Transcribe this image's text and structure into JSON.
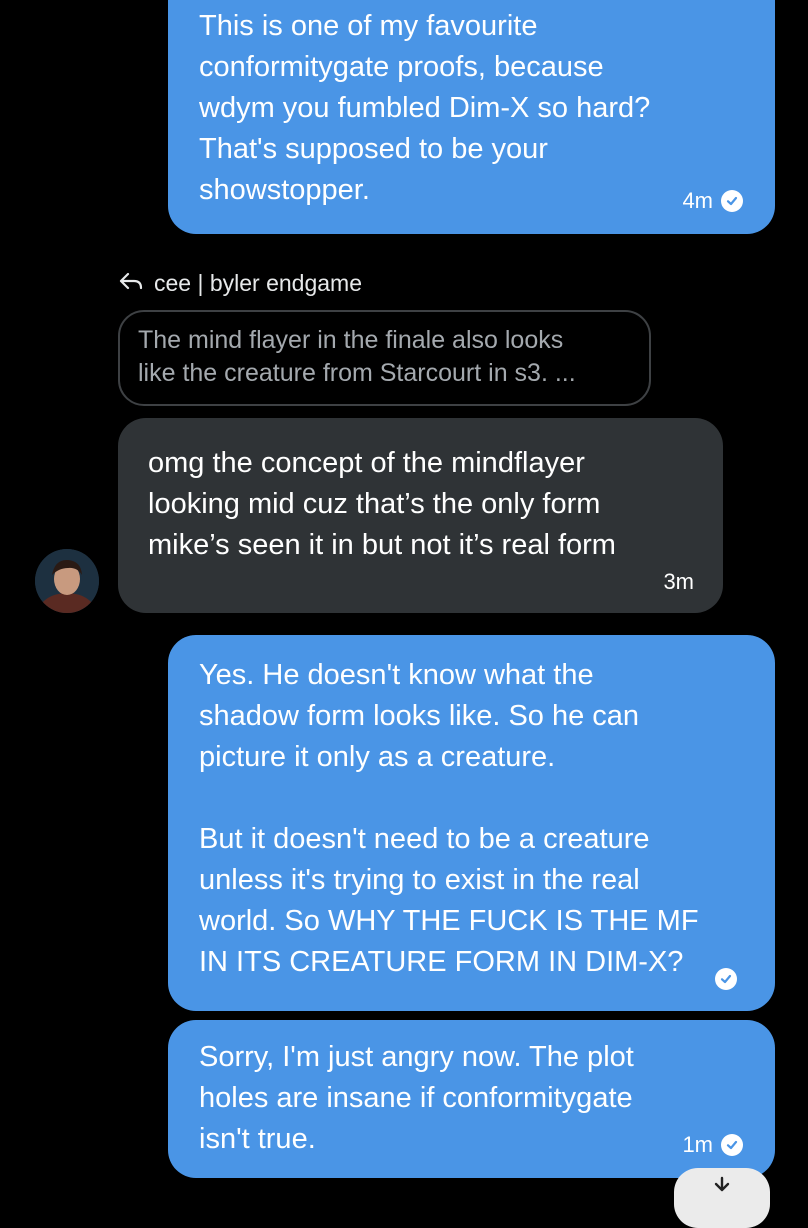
{
  "messages": [
    {
      "text": "This is one of my favourite\nconformitygate proofs, because\nwdym you fumbled Dim-X so hard?\nThat's supposed to be your\nshowstopper.",
      "time": "4m"
    },
    {
      "reply_to": {
        "name": "cee | byler endgame",
        "quote": "The mind flayer in the finale also looks\nlike the creature from Starcourt in s3. ..."
      },
      "text": "omg the concept of the mindflayer\nlooking mid cuz that’s the only form\nmike’s seen it in but not it’s real form",
      "time": "3m"
    },
    {
      "text": "Yes. He doesn't know what the\nshadow form looks like. So he can\npicture it only as a creature.\n\nBut it doesn't need to be a creature\nunless it's trying to exist in the real\nworld. So WHY THE FUCK IS THE MF\nIN ITS CREATURE FORM IN DIM-X?"
    },
    {
      "text": "Sorry, I'm just angry now. The plot\nholes are insane if conformitygate\nisn't true.",
      "time": "1m"
    }
  ],
  "colors": {
    "background": "#000000",
    "outgoing_bubble": "#4a95e6",
    "incoming_bubble": "#2f3336",
    "quote_border": "#3e4144"
  },
  "icons": {
    "read_receipt": "check-circle-icon",
    "reply": "reply-arrow-icon",
    "scroll_down": "chevron-down-icon"
  }
}
